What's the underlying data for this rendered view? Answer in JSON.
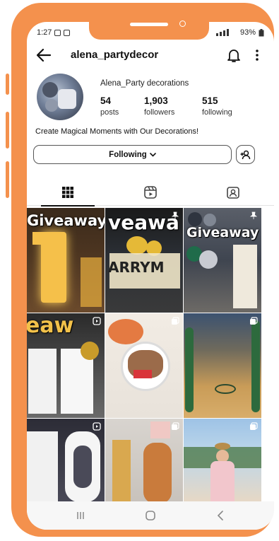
{
  "status_bar": {
    "time": "1:27",
    "battery": "93%"
  },
  "header": {
    "username": "alena_partydecor"
  },
  "profile": {
    "display_name": "Alena_Party decorations",
    "stats": [
      {
        "value": "54",
        "label": "posts"
      },
      {
        "value": "1,903",
        "label": "followers"
      },
      {
        "value": "515",
        "label": "following"
      }
    ],
    "bio": "Create Magical Moments with Our Decorations!"
  },
  "actions": {
    "following_label": "Following"
  },
  "grid": {
    "overlays": [
      "Giveaway",
      "veawa",
      "Giveaway",
      "eaw",
      "ARRYM",
      "ARRY"
    ]
  },
  "colors": {
    "frame": "#f4914d",
    "text": "#111111"
  }
}
